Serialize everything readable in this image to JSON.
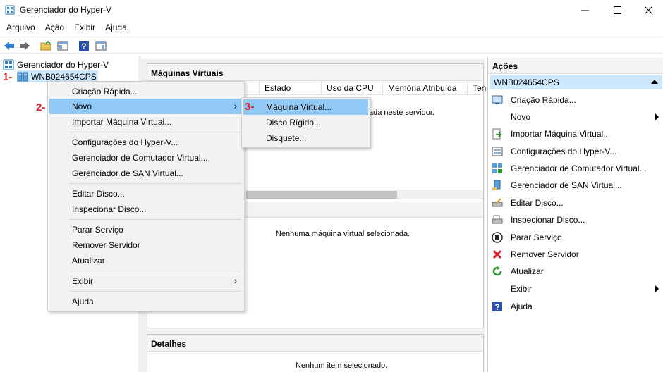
{
  "window": {
    "title": "Gerenciador do Hyper-V"
  },
  "menubar": [
    "Arquivo",
    "Ação",
    "Exibir",
    "Ajuda"
  ],
  "tree": {
    "root": "Gerenciador do Hyper-V",
    "server": "WNB024654CPS"
  },
  "center": {
    "vm_panel_title": "Máquinas Virtuais",
    "columns": [
      "Estado",
      "Uso da CPU",
      "Memória Atribuída",
      "Ten"
    ],
    "vm_empty_partial": "ada neste servidor.",
    "checkpoint_empty": "Nenhuma máquina virtual selecionada.",
    "details_title": "Detalhes",
    "details_empty": "Nenhum item selecionado."
  },
  "actions": {
    "title": "Ações",
    "server": "WNB024654CPS",
    "items": [
      {
        "label": "Criação Rápida...",
        "icon": "quick-create-icon"
      },
      {
        "label": "Novo",
        "icon": "none",
        "submenu": true
      },
      {
        "label": "Importar Máquina Virtual...",
        "icon": "import-icon"
      },
      {
        "label": "Configurações do Hyper-V...",
        "icon": "settings-icon"
      },
      {
        "label": "Gerenciador de Comutador Virtual...",
        "icon": "switch-icon"
      },
      {
        "label": "Gerenciador de SAN Virtual...",
        "icon": "san-icon"
      },
      {
        "label": "Editar Disco...",
        "icon": "edit-disk-icon"
      },
      {
        "label": "Inspecionar Disco...",
        "icon": "inspect-disk-icon"
      },
      {
        "label": "Parar Serviço",
        "icon": "stop-icon"
      },
      {
        "label": "Remover Servidor",
        "icon": "remove-icon"
      },
      {
        "label": "Atualizar",
        "icon": "refresh-icon"
      },
      {
        "label": "Exibir",
        "icon": "none",
        "submenu": true
      },
      {
        "label": "Ajuda",
        "icon": "help-icon"
      }
    ]
  },
  "context_menu": {
    "items": [
      "Criação Rápida...",
      "Novo",
      "Importar Máquina Virtual...",
      "Configurações do Hyper-V...",
      "Gerenciador de Comutador Virtual...",
      "Gerenciador de SAN Virtual...",
      "Editar Disco...",
      "Inspecionar Disco...",
      "Parar Serviço",
      "Remover Servidor",
      "Atualizar",
      "Exibir",
      "Ajuda"
    ],
    "highlighted": "Novo"
  },
  "submenu": {
    "items": [
      "Máquina Virtual...",
      "Disco Rígido...",
      "Disquete..."
    ],
    "highlighted": "Máquina Virtual..."
  },
  "steps": [
    "1-",
    "2-",
    "3-"
  ],
  "colors": {
    "selection": "#cce8ff",
    "menu_highlight": "#91c9f7",
    "step_marker": "#e0202a"
  }
}
